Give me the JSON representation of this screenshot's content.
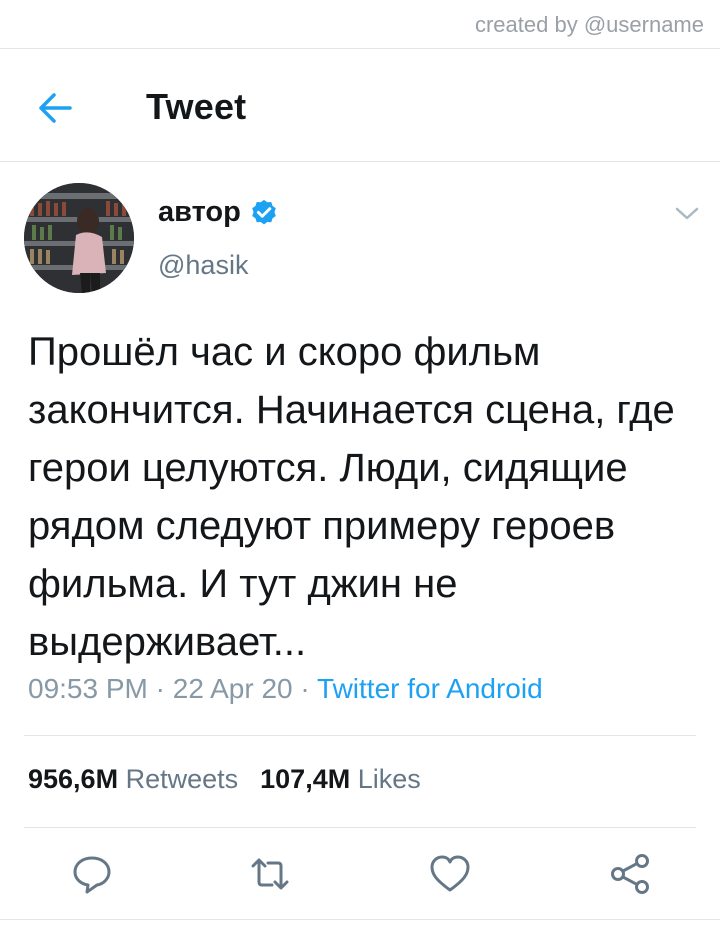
{
  "watermark": "created by @username",
  "header": {
    "title": "Tweet",
    "back_icon": "arrow-left-icon"
  },
  "author": {
    "display_name": "автор",
    "handle": "@hasik",
    "verified_icon": "verified-badge-icon",
    "menu_icon": "chevron-down-icon"
  },
  "tweet": {
    "text": "Прошёл час и скоро фильм закончится. Начинается сцена, где герои целуются. Люди, сидящие рядом следуют примеру героев фильма. И тут джин не выдерживает...",
    "time": "09:53 PM",
    "sep1": " · ",
    "date": "22 Apr 20",
    "sep2": " · ",
    "source": "Twitter for Android"
  },
  "stats": {
    "retweets_count": "956,6M",
    "retweets_label": "Retweets",
    "likes_count": "107,4M",
    "likes_label": "Likes"
  },
  "actions": [
    "reply-icon",
    "retweet-icon",
    "like-icon",
    "share-icon"
  ],
  "colors": {
    "accent": "#1da1f2",
    "secondary_text": "#657786",
    "divider": "#e1e5e9"
  }
}
